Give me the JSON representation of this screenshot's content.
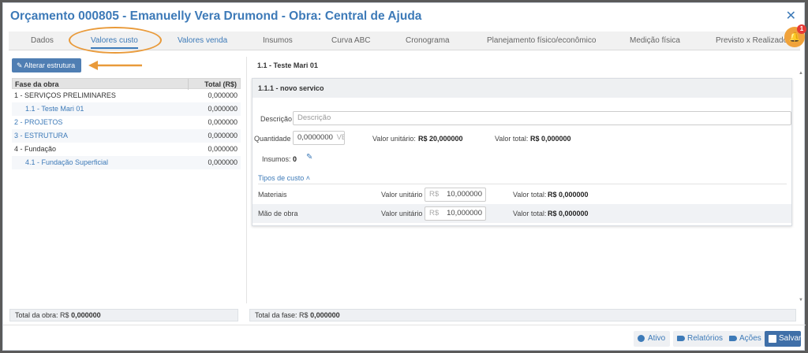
{
  "window": {
    "title": "Orçamento 000805 - Emanuelly Vera Drumond - Obra: Central de Ajuda",
    "close_glyph": "✕"
  },
  "tabs": [
    {
      "label": "Dados"
    },
    {
      "label": "Valores custo"
    },
    {
      "label": "Valores venda"
    },
    {
      "label": "Insumos"
    },
    {
      "label": "Curva ABC"
    },
    {
      "label": "Cronograma"
    },
    {
      "label": "Planejamento físico/econômico"
    },
    {
      "label": "Medição física"
    },
    {
      "label": "Previsto x Realizado"
    }
  ],
  "notifications": {
    "count": "1",
    "icon": "bell-icon"
  },
  "left": {
    "alter_button": "Alterar estrutura",
    "table": {
      "headers": [
        "Fase da obra",
        "Total (R$)"
      ],
      "rows": [
        {
          "phase": "1 - SERVIÇOS PRELIMINARES",
          "total": "0,000000"
        },
        {
          "phase": "1.1 - Teste Mari 01",
          "total": "0,000000"
        },
        {
          "phase": "2 - PROJETOS",
          "total": "0,000000"
        },
        {
          "phase": "3 - ESTRUTURA",
          "total": "0,000000"
        },
        {
          "phase": "4 - Fundação",
          "total": "0,000000"
        },
        {
          "phase": "4.1 - Fundação Superficial",
          "total": "0,000000"
        }
      ]
    },
    "footer_label": "Total da obra: R$",
    "footer_value": "0,000000"
  },
  "right": {
    "path": "1.1 - Teste Mari 01",
    "card_title": "1.1.1 - novo servico",
    "descricao_label": "Descrição",
    "descricao_placeholder": "Descrição",
    "quantidade_label": "Quantidade",
    "quantidade_value": "0,0000000",
    "quantidade_unit": "VB",
    "valor_unitario_label": "Valor unitário:",
    "valor_unitario_value": "R$ 20,000000",
    "valor_total_label": "Valor total:",
    "valor_total_value": "R$ 0,000000",
    "insumos_label": "Insumos:",
    "insumos_value": "0",
    "tipos_label": "Tipos de custo",
    "cost_types": [
      {
        "name": "Materiais",
        "unit_label": "Valor unitário",
        "currency": "R$",
        "unit_value": "10,000000",
        "total_label": "Valor total:",
        "total_value": "R$ 0,000000"
      },
      {
        "name": "Mão de obra",
        "unit_label": "Valor unitário",
        "currency": "R$",
        "unit_value": "10,000000",
        "total_label": "Valor total:",
        "total_value": "R$ 0,000000"
      }
    ],
    "footer_label": "Total da fase: R$",
    "footer_value": "0,000000"
  },
  "buttons": {
    "ativo": "Ativo",
    "relatorios": "Relatórios",
    "acoes": "Ações",
    "salvar": "Salvar"
  },
  "colors": {
    "accent": "#3d7ab8",
    "highlight": "#e99a3a",
    "bell": "#f0a23b"
  }
}
